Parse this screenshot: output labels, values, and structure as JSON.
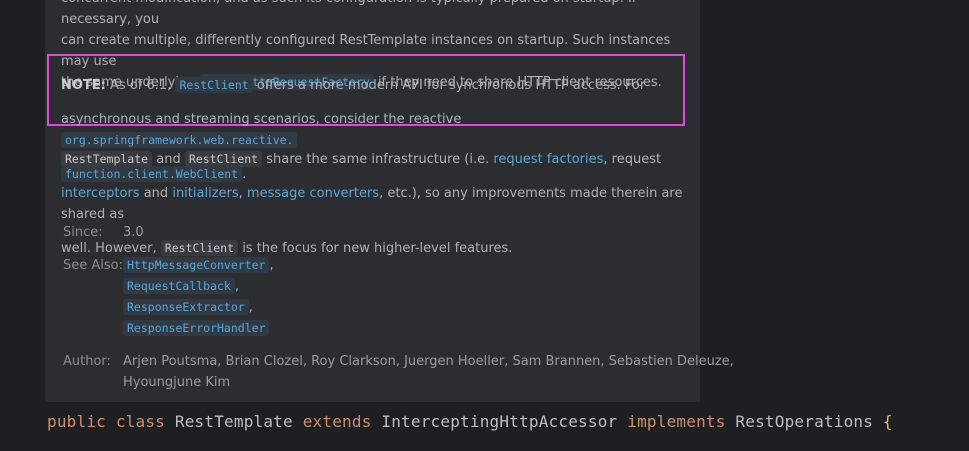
{
  "top_para": {
    "line1": "concurrent modification, and as such its configuration is typically prepared on startup. If necessary, you",
    "line2": "can create multiple, differently configured RestTemplate instances on startup. Such instances may use",
    "line3_pre": "the same underlying",
    "line3_code": "ClientHttpRequestFactory",
    "line3_post": "if they need to share HTTP client resources."
  },
  "note": {
    "label": "NOTE:",
    "text1": "As of 6.1,",
    "code1": "RestClient",
    "text2": "offers a more modern API for synchronous HTTP access. For",
    "text3": "asynchronous and streaming scenarios, consider the reactive",
    "code2a": "org.springframework.web.reactive.",
    "code2b": "function.client.WebClient",
    "end": "."
  },
  "share_para": {
    "code1": "RestTemplate",
    "and": "and",
    "code2": "RestClient",
    "t1": "share the same infrastructure (i.e.",
    "link1": "request factories",
    "t2": ", request",
    "link2": "interceptors",
    "t3": "and",
    "link3": "initializers",
    "t4": ",",
    "link4": "message converters",
    "t5": ", etc.), so any improvements made therein are shared as",
    "t6": "well. However,",
    "code3": "RestClient",
    "t7": "is the focus for new higher-level features."
  },
  "meta": {
    "since_label": "Since:",
    "since_value": "3.0",
    "see_label": "See Also:",
    "see_items": [
      "HttpMessageConverter",
      "RequestCallback",
      "ResponseExtractor",
      "ResponseErrorHandler"
    ],
    "author_label": "Author:",
    "author_line1": "Arjen Poutsma, Brian Clozel, Roy Clarkson, Juergen Hoeller, Sam Brannen, Sebastien Deleuze,",
    "author_line2": "Hyoungjune Kim"
  },
  "code": {
    "kw_public": "public",
    "kw_class": "class",
    "name": "RestTemplate",
    "kw_extends": "extends",
    "parent": "InterceptingHttpAccessor",
    "kw_implements": "implements",
    "iface": "RestOperations",
    "brace": "{"
  }
}
